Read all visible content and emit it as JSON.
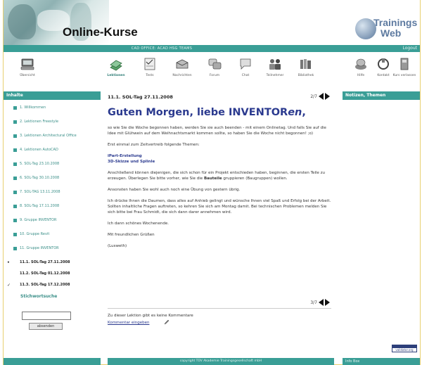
{
  "header": {
    "site_title": "Online-Kurse",
    "logo_line1": "Trainings",
    "logo_line2": "Web",
    "bar_center": "CAD OFFICE: ACAD HSG TEAMS",
    "bar_right": "Logout"
  },
  "toolbar": {
    "items": [
      {
        "label": "Übersicht",
        "icon": "computer-icon"
      },
      {
        "label": "Lektionen",
        "icon": "book-icon",
        "active": true
      },
      {
        "label": "Tests",
        "icon": "test-icon"
      },
      {
        "label": "Nachrichten",
        "icon": "messages-icon"
      },
      {
        "label": "Forum",
        "icon": "forum-icon"
      },
      {
        "label": "Chat",
        "icon": "chat-icon"
      },
      {
        "label": "Teilnehmer",
        "icon": "participants-icon"
      },
      {
        "label": "Bibliothek",
        "icon": "library-icon"
      },
      {
        "label": "Hilfe",
        "icon": "help-icon"
      },
      {
        "label": "Kontakt",
        "icon": "contact-icon"
      },
      {
        "label": "Kurs verlassen",
        "icon": "exit-icon"
      }
    ]
  },
  "sidebar": {
    "title": "Inhalte",
    "items": [
      {
        "label": "1. Willkommen",
        "level": 0
      },
      {
        "label": "2. Lektionen Freestyle",
        "level": 0
      },
      {
        "label": "3. Lektionen Architectural Office",
        "level": 0
      },
      {
        "label": "4. Lektionen AutoCAD",
        "level": 0
      },
      {
        "label": "5. SOL-Tag 23.10.2008",
        "level": 0
      },
      {
        "label": "6. SOL-Tag 30.10.2008",
        "level": 0
      },
      {
        "label": "7. SOL-TAG 13.11.2008",
        "level": 0
      },
      {
        "label": "8. SOL-Tag 17.11.2008",
        "level": 0
      },
      {
        "label": "9. Gruppe INVENTOR",
        "level": 0
      },
      {
        "label": "10. Gruppe Revit",
        "level": 0
      },
      {
        "label": "11. Gruppe INVENTOR",
        "level": 0
      },
      {
        "label": "11.1. SOL-Tag 27.11.2008",
        "level": 1,
        "mark": "•"
      },
      {
        "label": "11.2. SOL-Tag 01.12.2008",
        "level": 1,
        "mark": ""
      },
      {
        "label": "11.3. SOL-Tag 17.12.2008",
        "level": 1,
        "mark": "✓"
      }
    ],
    "search_label": "Stichwortsuche",
    "search_value": "",
    "search_button": "absenden"
  },
  "main": {
    "breadcrumb": "11.1. SOL-Tag 27.11.2008",
    "page_indicator": "2/7",
    "headline_main": "Guten Morgen, liebe INVENTOR",
    "headline_italic": "en",
    "headline_tail": ",",
    "paragraphs": [
      "so wie Sie die Woche begonnen haben, werden Sie sie auch beenden - mit einem Onlinetag. Und falls Sie auf die Idee mit Glühwein auf dem Weihnachtsmarkt kommen sollte, so haben Sie die Woche nicht begonnen! ;o)",
      "Erst einmal zum Zeitvertreib folgende Themen:",
      "Anschließend können diejenigen, die sich schon für ein Projekt entschieden haben, beginnen, die ersten Teile zu erzeugen. Überlegen Sie bitte vorher, wie Sie die Bauteile gruppieren (Baugruppen) wollen.",
      "Ansonsten haben Sie wohl auch noch eine Übung von gestern übrig.",
      "Ich drücke Ihnen die Daumen, dass alles auf Anhieb gelingt und wünsche Ihnen viel Spaß und Erfolg bei der Arbeit. Sollten inhaltliche Fragen auftreten, so kehren Sie sich am Montag damit. Bei technischen Problemen melden Sie sich bitte bei Frau Schmidt, die sich dann darer annehmen wird.",
      "Ich dann schönes Wochenende.",
      "Mit freundlichen Grüßen",
      "(Lusweth)"
    ],
    "topics": [
      "iPart-Erstellung",
      "3D-Skizze und Splinle"
    ],
    "bold_word": "Bauteile",
    "footer_page": "3/7",
    "no_comments": "Zu dieser Lektion gibt es keine Kommentare",
    "comment_link": "Kommentar eingeben",
    "footer_bar": "copyright TÜV Akademie Trainingsgesellschaft mbH"
  },
  "right": {
    "title": "Notizen, Themen",
    "footer": "Info Box",
    "badge": "validator.org"
  },
  "colors": {
    "teal": "#3a9e96",
    "headline": "#2b3a8f",
    "border": "#e8d070"
  }
}
